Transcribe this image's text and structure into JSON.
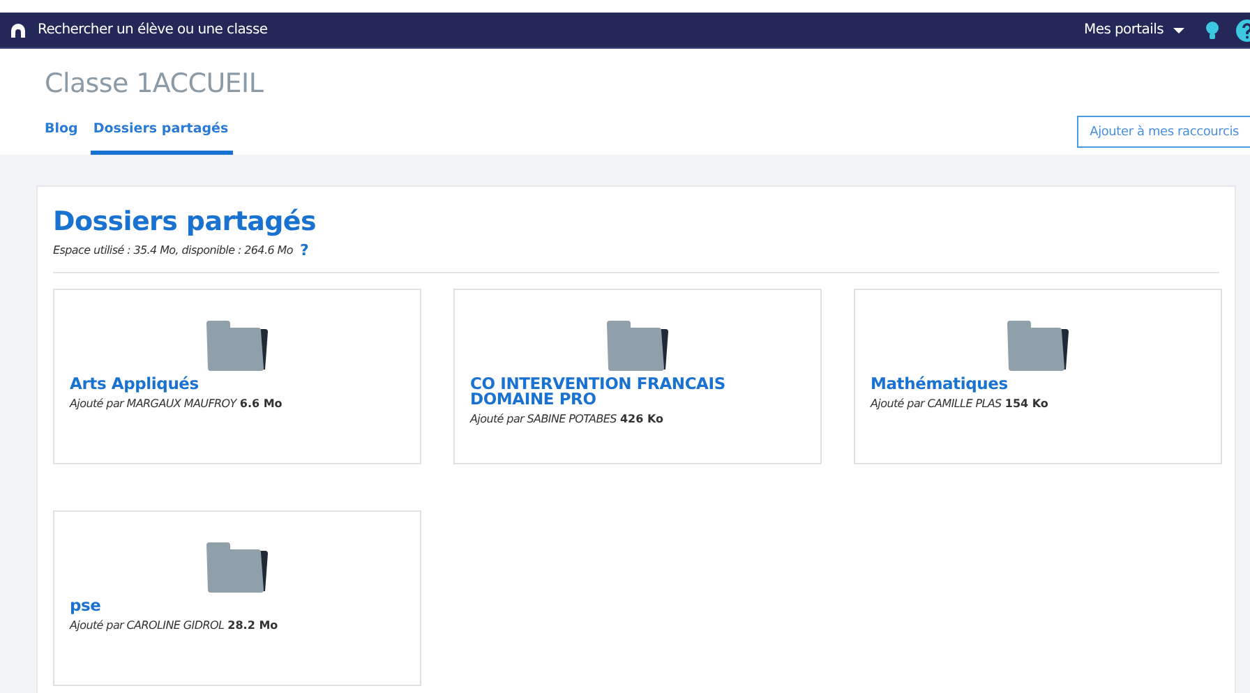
{
  "navbar": {
    "search_label": "Rechercher un élève ou une classe",
    "portals": "Mes portails"
  },
  "page": {
    "title": "Classe 1ACCUEIL",
    "tabs": [
      {
        "label": "Blog",
        "selected": false
      },
      {
        "label": "Dossiers partagés",
        "selected": true
      }
    ],
    "shortcut_button": "Ajouter à mes raccourcis"
  },
  "panel": {
    "title": "Dossiers partagés",
    "usage": "Espace utilisé : 35.4 Mo, disponible : 264.6 Mo",
    "help": "?"
  },
  "folders": [
    {
      "name": "Arts Appliqués",
      "added_by": "Ajouté par MARGAUX MAUFROY",
      "size": "6.6 Mo"
    },
    {
      "name": "CO INTERVENTION FRANCAIS DOMAINE PRO",
      "added_by": "Ajouté par SABINE POTABES",
      "size": "426 Ko"
    },
    {
      "name": "Mathématiques",
      "added_by": "Ajouté par CAMILLE PLAS",
      "size": "154 Ko"
    },
    {
      "name": "pse",
      "added_by": "Ajouté par CAROLINE GIDROL",
      "size": "28.2 Mo"
    }
  ]
}
